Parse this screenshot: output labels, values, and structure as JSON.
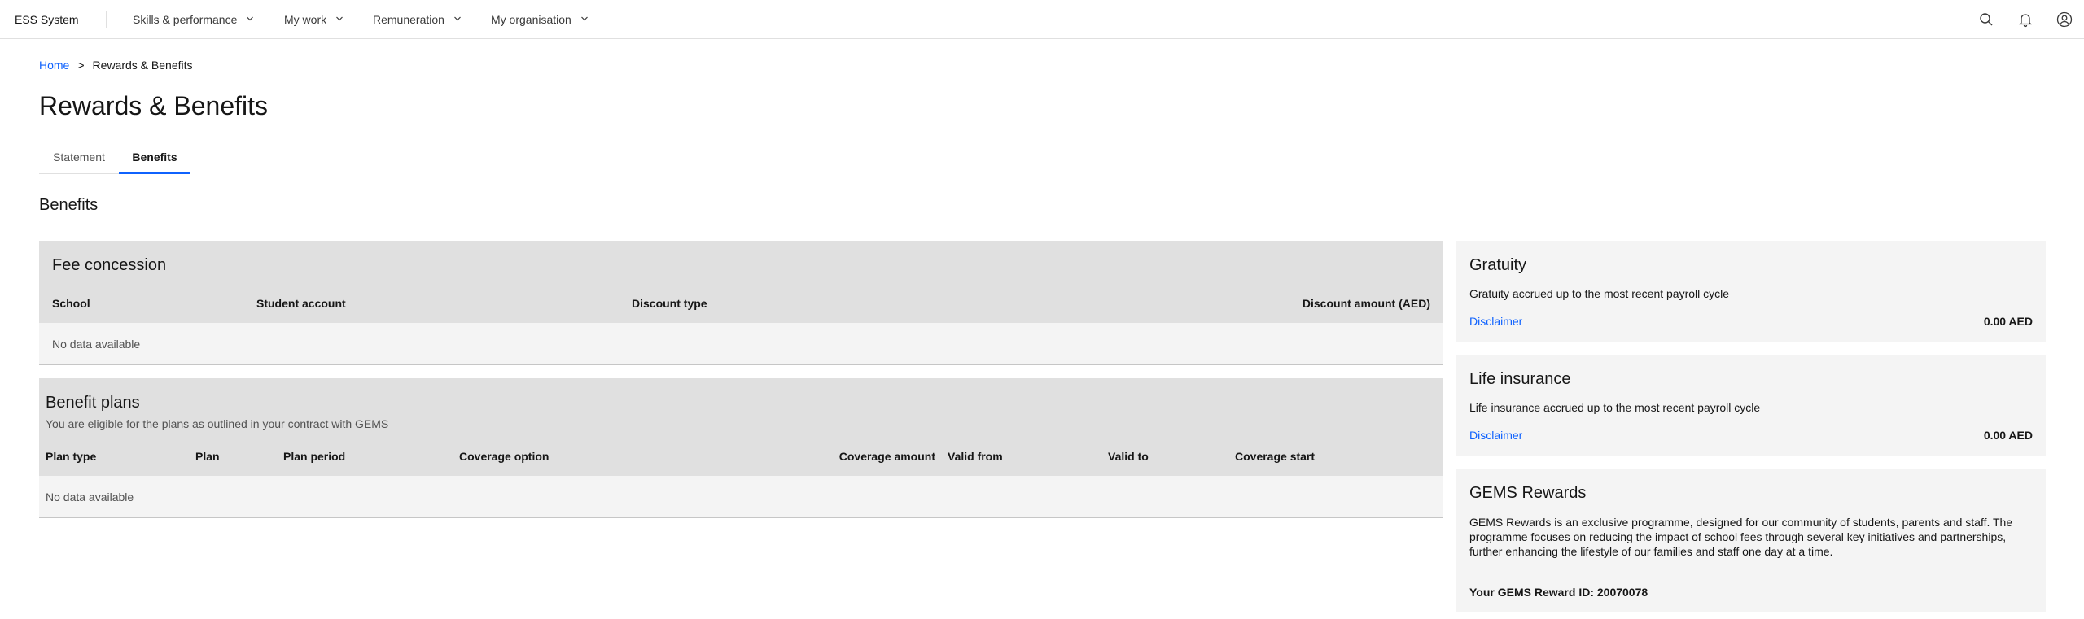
{
  "header": {
    "brand": "ESS System",
    "nav": [
      {
        "label": "Skills & performance"
      },
      {
        "label": "My work"
      },
      {
        "label": "Remuneration"
      },
      {
        "label": "My organisation"
      }
    ],
    "icons": [
      "search-icon",
      "notification-icon",
      "user-avatar-icon"
    ]
  },
  "breadcrumb": {
    "home": "Home",
    "separator": ">",
    "current": "Rewards & Benefits"
  },
  "page_title": "Rewards & Benefits",
  "tabs": [
    {
      "label": "Statement",
      "active": false
    },
    {
      "label": "Benefits",
      "active": true
    }
  ],
  "section_title": "Benefits",
  "fee_concession": {
    "title": "Fee concession",
    "columns": [
      "School",
      "Student account",
      "Discount type",
      "Discount amount (AED)"
    ],
    "empty": "No data available"
  },
  "benefit_plans": {
    "title": "Benefit plans",
    "subtitle": "You are eligible for the plans as outlined in your contract with GEMS",
    "columns": [
      "Plan type",
      "Plan",
      "Plan period",
      "Coverage option",
      "Coverage amount",
      "Valid from",
      "Valid to",
      "Coverage start"
    ],
    "empty": "No data available"
  },
  "gratuity": {
    "title": "Gratuity",
    "text": "Gratuity accrued up to the most recent payroll cycle",
    "link": "Disclaimer",
    "amount": "0.00 AED"
  },
  "life_insurance": {
    "title": "Life insurance",
    "text": "Life insurance accrued up to the most recent payroll cycle",
    "link": "Disclaimer",
    "amount": "0.00 AED"
  },
  "gems_rewards": {
    "title": "GEMS Rewards",
    "description": "GEMS Rewards is an exclusive programme, designed for our community of students, parents and staff. The programme focuses on reducing the impact of school fees through several key initiatives and partnerships, further enhancing the lifestyle of our families and staff one day at a time.",
    "reward_id": "Your GEMS Reward ID: 20070078"
  },
  "colors": {
    "link": "#0f62fe",
    "panel_header": "#e0e0e0",
    "panel_body": "#f4f4f4"
  }
}
